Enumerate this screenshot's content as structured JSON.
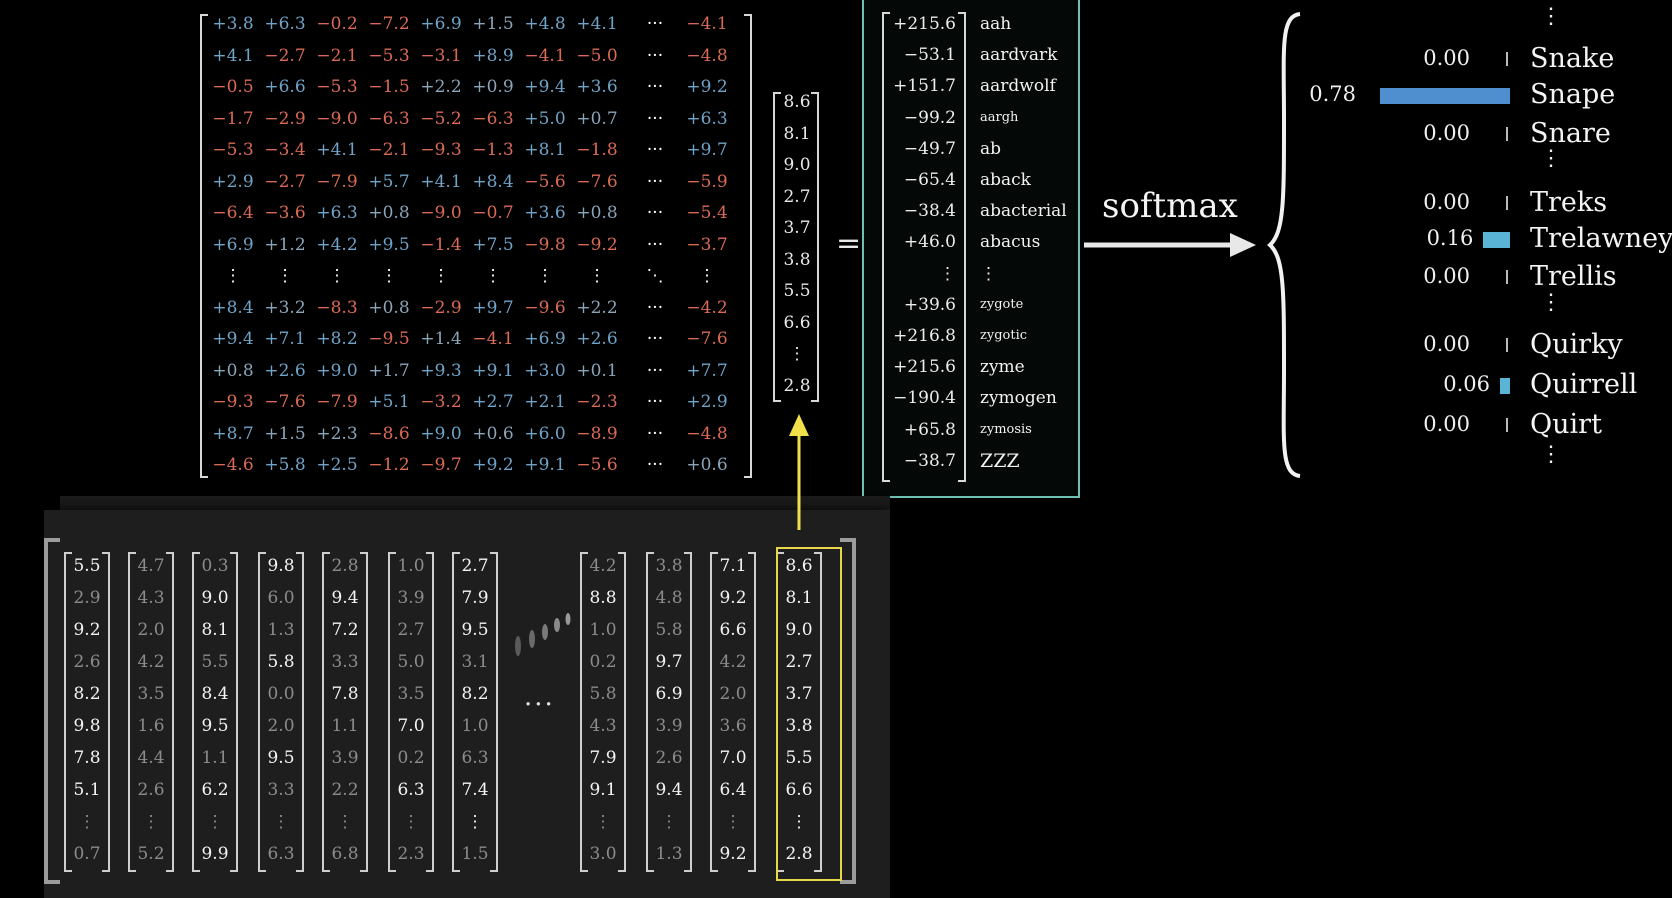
{
  "weight_matrix": {
    "rows": [
      [
        "+3.8",
        "+6.3",
        "−0.2",
        "−7.2",
        "+6.9",
        "+1.5",
        "+4.8",
        "+4.1",
        "···",
        "−4.1"
      ],
      [
        "+4.1",
        "−2.7",
        "−2.1",
        "−5.3",
        "−3.1",
        "+8.9",
        "−4.1",
        "−5.0",
        "···",
        "−4.8"
      ],
      [
        "−0.5",
        "+6.6",
        "−5.3",
        "−1.5",
        "+2.2",
        "+0.9",
        "+9.4",
        "+3.6",
        "···",
        "+9.2"
      ],
      [
        "−1.7",
        "−2.9",
        "−9.0",
        "−6.3",
        "−5.2",
        "−6.3",
        "+5.0",
        "+0.7",
        "···",
        "+6.3"
      ],
      [
        "−5.3",
        "−3.4",
        "+4.1",
        "−2.1",
        "−9.3",
        "−1.3",
        "+8.1",
        "−1.8",
        "···",
        "+9.7"
      ],
      [
        "+2.9",
        "−2.7",
        "−7.9",
        "+5.7",
        "+4.1",
        "+8.4",
        "−5.6",
        "−7.6",
        "···",
        "−5.9"
      ],
      [
        "−6.4",
        "−3.6",
        "+6.3",
        "+0.8",
        "−9.0",
        "−0.7",
        "+3.6",
        "+0.8",
        "···",
        "−5.4"
      ],
      [
        "+6.9",
        "+1.2",
        "+4.2",
        "+9.5",
        "−1.4",
        "+7.5",
        "−9.8",
        "−9.2",
        "···",
        "−3.7"
      ],
      [
        "⋮",
        "⋮",
        "⋮",
        "⋮",
        "⋮",
        "⋮",
        "⋮",
        "⋮",
        "⋱",
        "⋮"
      ],
      [
        "+8.4",
        "+3.2",
        "−8.3",
        "+0.8",
        "−2.9",
        "+9.7",
        "−9.6",
        "+2.2",
        "···",
        "−4.2"
      ],
      [
        "+9.4",
        "+7.1",
        "+8.2",
        "−9.5",
        "+1.4",
        "−4.1",
        "+6.9",
        "+2.6",
        "···",
        "−7.6"
      ],
      [
        "+0.8",
        "+2.6",
        "+9.0",
        "+1.7",
        "+9.3",
        "+9.1",
        "+3.0",
        "+0.1",
        "···",
        "+7.7"
      ],
      [
        "−9.3",
        "−7.6",
        "−7.9",
        "+5.1",
        "−3.2",
        "+2.7",
        "+2.1",
        "−2.3",
        "···",
        "+2.9"
      ],
      [
        "+8.7",
        "+1.5",
        "+2.3",
        "−8.6",
        "+9.0",
        "+0.6",
        "+6.0",
        "−8.9",
        "···",
        "−4.8"
      ],
      [
        "−4.6",
        "+5.8",
        "+2.5",
        "−1.2",
        "−9.7",
        "+9.2",
        "+9.1",
        "−5.6",
        "···",
        "+0.6"
      ]
    ]
  },
  "input_vector": [
    "8.6",
    "8.1",
    "9.0",
    "2.7",
    "3.7",
    "3.8",
    "5.5",
    "6.6",
    "⋮",
    "2.8"
  ],
  "equals_sign": "=",
  "logits": [
    {
      "value": "+215.6",
      "word": "aah",
      "size": "normal"
    },
    {
      "value": "−53.1",
      "word": "aardvark",
      "size": "normal"
    },
    {
      "value": "+151.7",
      "word": "aardwolf",
      "size": "normal"
    },
    {
      "value": "−99.2",
      "word": "aargh",
      "size": "small"
    },
    {
      "value": "−49.7",
      "word": "ab",
      "size": "normal"
    },
    {
      "value": "−65.4",
      "word": "aback",
      "size": "normal"
    },
    {
      "value": "−38.4",
      "word": "abacterial",
      "size": "normal"
    },
    {
      "value": "+46.0",
      "word": "abacus",
      "size": "normal"
    },
    {
      "value": "⋮",
      "word": "⋮",
      "size": "normal"
    },
    {
      "value": "+39.6",
      "word": "zygote",
      "size": "small"
    },
    {
      "value": "+216.8",
      "word": "zygotic",
      "size": "small"
    },
    {
      "value": "+215.6",
      "word": "zyme",
      "size": "normal"
    },
    {
      "value": "−190.4",
      "word": "zymogen",
      "size": "normal"
    },
    {
      "value": "+65.8",
      "word": "zymosis",
      "size": "small"
    },
    {
      "value": "−38.7",
      "word": "ZZZ",
      "size": "big"
    }
  ],
  "softmax_label": "softmax",
  "probabilities": [
    {
      "type": "dots"
    },
    {
      "type": "item",
      "prob": "0.00",
      "name": "Snake",
      "value": 0.0,
      "color": "#bbbbbb"
    },
    {
      "type": "item",
      "prob": "0.78",
      "name": "Snape",
      "value": 0.78,
      "color": "#4f8fd0"
    },
    {
      "type": "item",
      "prob": "0.00",
      "name": "Snare",
      "value": 0.0,
      "color": "#bbbbbb"
    },
    {
      "type": "dots"
    },
    {
      "type": "item",
      "prob": "0.00",
      "name": "Treks",
      "value": 0.0,
      "color": "#bbbbbb"
    },
    {
      "type": "item",
      "prob": "0.16",
      "name": "Trelawney",
      "value": 0.16,
      "color": "#5ab4d6"
    },
    {
      "type": "item",
      "prob": "0.00",
      "name": "Trellis",
      "value": 0.0,
      "color": "#bbbbbb"
    },
    {
      "type": "dots"
    },
    {
      "type": "item",
      "prob": "0.00",
      "name": "Quirky",
      "value": 0.0,
      "color": "#bbbbbb"
    },
    {
      "type": "item",
      "prob": "0.06",
      "name": "Quirrell",
      "value": 0.06,
      "color": "#5ab4d6"
    },
    {
      "type": "item",
      "prob": "0.00",
      "name": "Quirt",
      "value": 0.0,
      "color": "#bbbbbb"
    },
    {
      "type": "dots"
    }
  ],
  "embedding_columns": [
    [
      "5.5",
      "2.9",
      "9.2",
      "2.6",
      "8.2",
      "9.8",
      "7.8",
      "5.1",
      "⋮",
      "0.7"
    ],
    [
      "4.7",
      "4.3",
      "2.0",
      "4.2",
      "3.5",
      "1.6",
      "4.4",
      "2.6",
      "⋮",
      "5.2"
    ],
    [
      "0.3",
      "9.0",
      "8.1",
      "5.5",
      "8.4",
      "9.5",
      "1.1",
      "6.2",
      "⋮",
      "9.9"
    ],
    [
      "9.8",
      "6.0",
      "1.3",
      "5.8",
      "0.0",
      "2.0",
      "9.5",
      "3.3",
      "⋮",
      "6.3"
    ],
    [
      "2.8",
      "9.4",
      "7.2",
      "3.3",
      "7.8",
      "1.1",
      "3.9",
      "2.2",
      "⋮",
      "6.8"
    ],
    [
      "1.0",
      "3.9",
      "2.7",
      "5.0",
      "3.5",
      "7.0",
      "0.2",
      "6.3",
      "⋮",
      "2.3"
    ],
    [
      "2.7",
      "7.9",
      "9.5",
      "3.1",
      "8.2",
      "1.0",
      "6.3",
      "7.4",
      "⋮",
      "1.5"
    ],
    [
      "4.2",
      "8.8",
      "1.0",
      "0.2",
      "5.8",
      "4.3",
      "7.9",
      "9.1",
      "⋮",
      "3.0"
    ],
    [
      "3.8",
      "4.8",
      "5.8",
      "9.7",
      "6.9",
      "3.9",
      "2.6",
      "9.4",
      "⋮",
      "1.3"
    ],
    [
      "7.1",
      "9.2",
      "6.6",
      "4.2",
      "2.0",
      "3.6",
      "7.0",
      "6.4",
      "⋮",
      "9.2"
    ],
    [
      "8.6",
      "8.1",
      "9.0",
      "2.7",
      "3.7",
      "3.8",
      "5.5",
      "6.6",
      "⋮",
      "2.8"
    ]
  ],
  "ellipsis": "···"
}
